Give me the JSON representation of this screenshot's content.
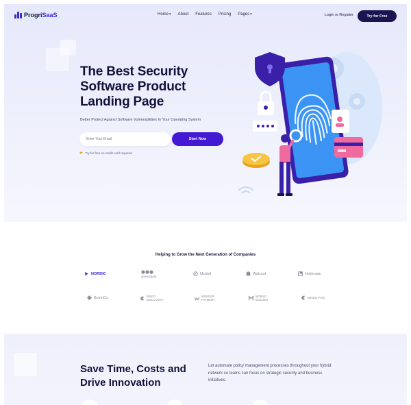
{
  "brand": {
    "name_part1": "Progri",
    "name_part2": "SaaS"
  },
  "nav": {
    "items": [
      {
        "label": "Home",
        "has_caret": true
      },
      {
        "label": "About",
        "has_caret": false
      },
      {
        "label": "Features",
        "has_caret": false
      },
      {
        "label": "Pricing",
        "has_caret": false
      },
      {
        "label": "Pages",
        "has_caret": true
      }
    ],
    "login": "Login",
    "or": "or",
    "register": "Register",
    "cta": "Try for Free"
  },
  "hero": {
    "headline_line1": "The Best Security",
    "headline_line2": "Software Product",
    "headline_line3": "Landing Page",
    "subline": "Better Protect Against Software Vulnerabilities In Your  Operating System",
    "email_placeholder": "Enter Your Email",
    "start_button": "Start Now",
    "note": "Try for free no credit card required"
  },
  "partners": {
    "title": "Helping to Grow the Next Generation of Companies",
    "row1": [
      "NORDIC",
      "greenspant",
      "Modali",
      "Walcool",
      "Holdmate"
    ],
    "row2": [
      "BusinOs",
      "BINDO DISCOVERY",
      "WONDER PAYMENT",
      "MOBILE BUILDER",
      "BINDO POS"
    ]
  },
  "features": {
    "title_line1": "Save Time, Costs and",
    "title_line2": "Drive Innovation",
    "text": "Let automate policy management processes throughout your hybrid network so teams can focus on strategic security and business initiatives."
  },
  "colors": {
    "primary": "#4319d3",
    "dark": "#1a1550",
    "brand_accent": "#3a2ad1",
    "hero_bg": "#e6e9fb"
  }
}
